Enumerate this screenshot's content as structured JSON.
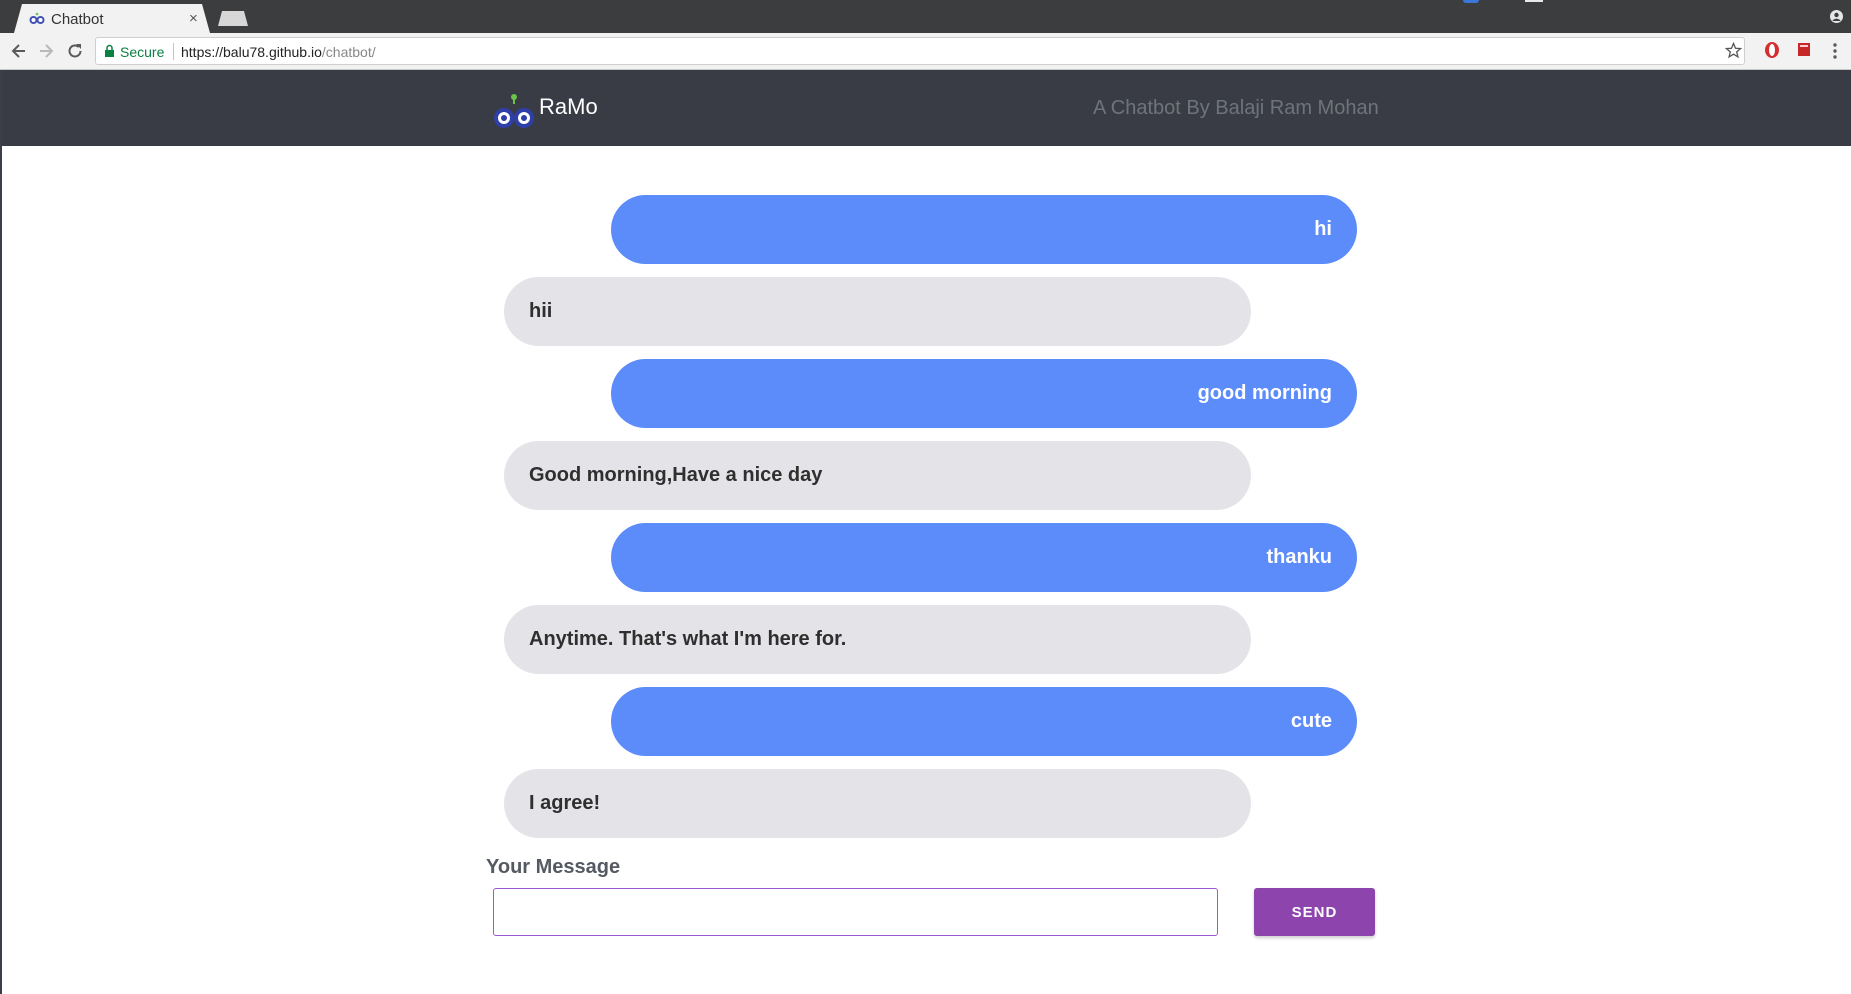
{
  "browser": {
    "tab_title": "Chatbot",
    "tab_close": "×",
    "secure_label": "Secure",
    "url_host": "https://balu78.github.io",
    "url_path": "/chatbot/"
  },
  "header": {
    "brand": "RaMo",
    "tagline": "A Chatbot By Balaji Ram Mohan"
  },
  "messages": [
    {
      "from": "user",
      "text": "hi"
    },
    {
      "from": "bot",
      "text": "hii"
    },
    {
      "from": "user",
      "text": "good morning"
    },
    {
      "from": "bot",
      "text": "Good morning,Have a nice day"
    },
    {
      "from": "user",
      "text": "thanku"
    },
    {
      "from": "bot",
      "text": "Anytime. That's what I'm here for."
    },
    {
      "from": "user",
      "text": "cute"
    },
    {
      "from": "bot",
      "text": "I agree!"
    }
  ],
  "composer": {
    "label": "Your Message",
    "value": "",
    "send_label": "SEND"
  },
  "colors": {
    "header_bg": "#393c44",
    "user_bubble": "#5c8bfa",
    "bot_bubble": "#e4e4e8",
    "send_button": "#8e44ad",
    "input_border": "#9b59d0"
  },
  "icons": {
    "logo": "owl-logo-icon",
    "back": "arrow-left-icon",
    "forward": "arrow-right-icon",
    "reload": "reload-icon",
    "lock": "lock-icon",
    "bookmark": "star-icon",
    "menu": "kebab-menu-icon"
  }
}
